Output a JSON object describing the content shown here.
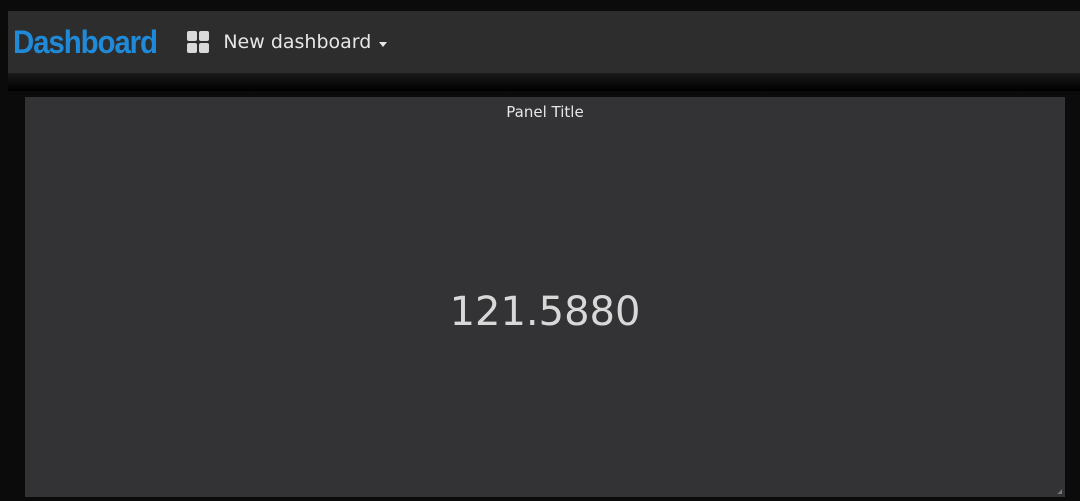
{
  "navbar": {
    "brand": "Dashboard",
    "dashboard_name": "New dashboard",
    "icons": {
      "dashboard_picker": "grid-icon",
      "dropdown": "caret-down-icon"
    },
    "colors": {
      "brand": "#1f8ad8",
      "background": "#2d2d2e"
    }
  },
  "panel": {
    "title": "Panel Title",
    "value": "121.5880",
    "colors": {
      "background": "#333335",
      "value_text": "#d8d8d8"
    }
  }
}
